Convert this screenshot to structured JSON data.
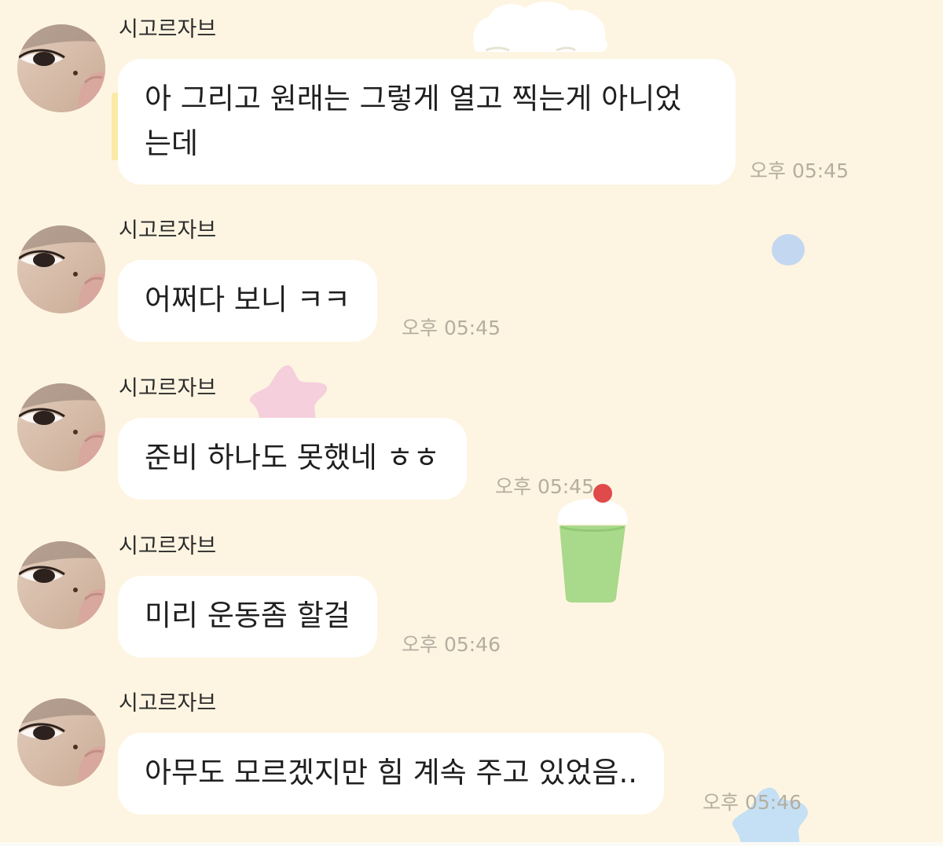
{
  "chat": {
    "messages": [
      {
        "sender": "시고르자브",
        "lines": [
          "아 그리고 원래는 그렇게 열고 찍는게 아니었",
          "는데"
        ],
        "time": "오후 05:45"
      },
      {
        "sender": "시고르자브",
        "lines": [
          "어쩌다 보니 ㅋㅋ"
        ],
        "time": "오후 05:45"
      },
      {
        "sender": "시고르자브",
        "lines": [
          "준비 하나도 못했네 ㅎㅎ"
        ],
        "time": "오후 05:45"
      },
      {
        "sender": "시고르자브",
        "lines": [
          "미리 운동좀 할걸"
        ],
        "time": "오후 05:46"
      },
      {
        "sender": "시고르자브",
        "lines": [
          "아무도 모르겠지만 힘 계속 주고 있었음.."
        ],
        "time": "오후 05:46"
      }
    ]
  },
  "icons": {
    "avatar": "profile-photo-icon",
    "decorations": [
      "cloud-icon",
      "blue-dot-icon",
      "pink-star-icon",
      "ice-cream-icon",
      "blue-star-icon",
      "yellow-cup-icon"
    ]
  },
  "colors": {
    "background": "#fdf5e2",
    "bubble": "#ffffff",
    "timestamp": "#b5aea0",
    "text": "#1f1f1f"
  }
}
